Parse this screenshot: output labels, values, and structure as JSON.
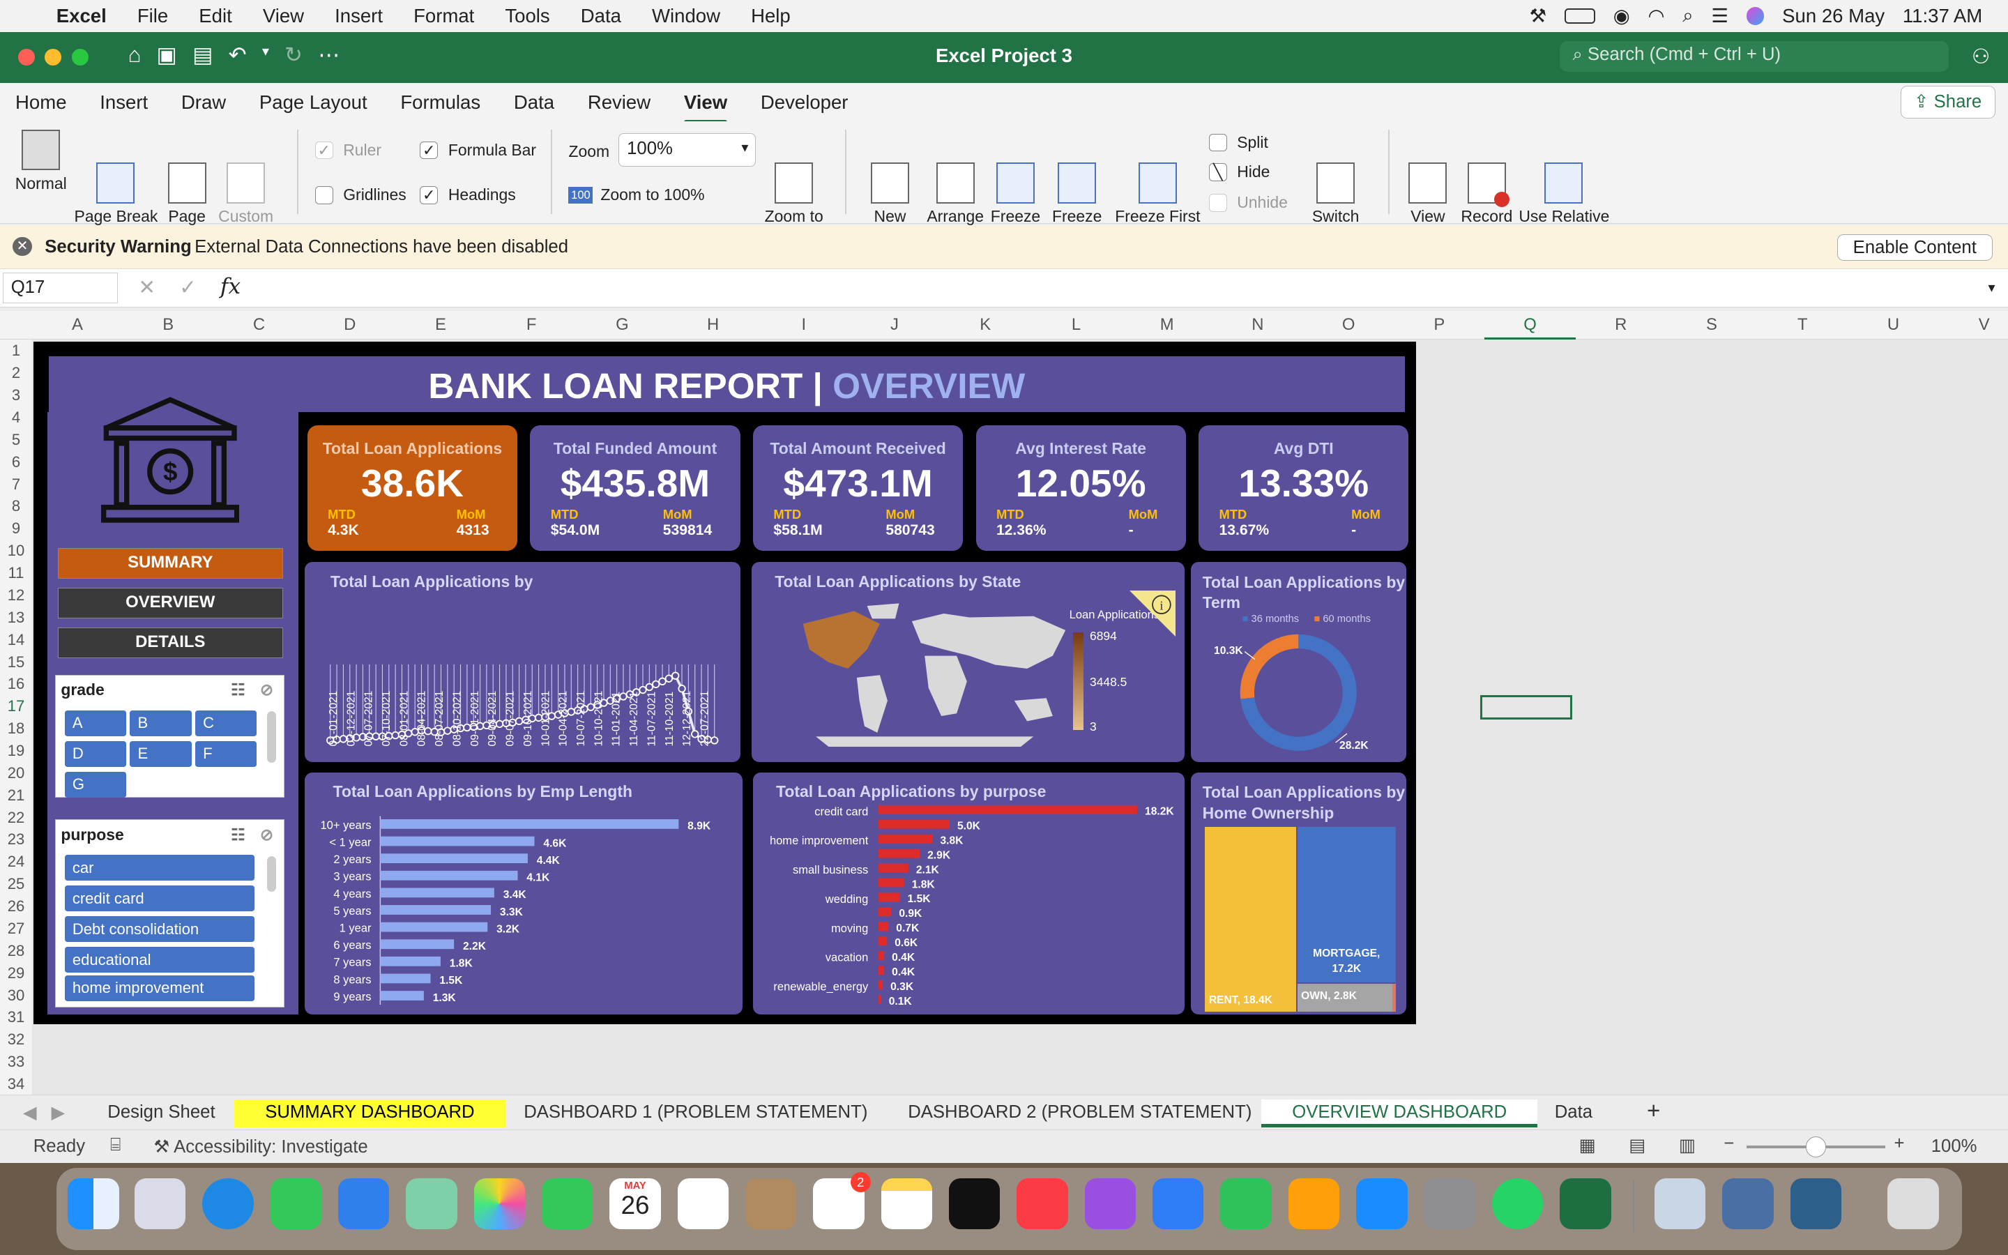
{
  "menubar": {
    "apple": "",
    "app": "Excel",
    "items": [
      "File",
      "Edit",
      "View",
      "Insert",
      "Format",
      "Tools",
      "Data",
      "Window",
      "Help"
    ],
    "date": "Sun 26 May",
    "time": "11:37 AM"
  },
  "window": {
    "title": "Excel Project 3",
    "search_placeholder": "Search (Cmd + Ctrl + U)"
  },
  "ribbon_tabs": [
    "Home",
    "Insert",
    "Draw",
    "Page Layout",
    "Formulas",
    "Data",
    "Review",
    "View",
    "Developer"
  ],
  "active_tab": "View",
  "share_label": "Share",
  "ribbon": {
    "normal": "Normal",
    "page_break": "Page Break\nPreview",
    "page_layout": "Page\nLayout",
    "custom_views": "Custom\nViews",
    "ruler": "Ruler",
    "formula_bar": "Formula Bar",
    "gridlines": "Gridlines",
    "headings": "Headings",
    "zoom_label": "Zoom",
    "zoom_value": "100%",
    "zoom_100": "Zoom to 100%",
    "zoom_badge": "100",
    "zoom_sel": "Zoom to\nSelection",
    "new_window": "New\nWindow",
    "arrange_all": "Arrange\nAll",
    "freeze_panes": "Freeze\nPanes",
    "freeze_top": "Freeze\nTop Row",
    "freeze_first": "Freeze First\nColumn",
    "split": "Split",
    "hide": "Hide",
    "unhide": "Unhide",
    "switch": "Switch\nWindows",
    "view_macros": "View\nMacros",
    "record_macro": "Record\nMacro",
    "relative": "Use Relative\nReferences"
  },
  "security": {
    "title": "Security Warning",
    "message": "External Data Connections have been disabled",
    "button": "Enable Content"
  },
  "formula": {
    "namebox": "Q17",
    "fx": "fx"
  },
  "columns": [
    "A",
    "B",
    "C",
    "D",
    "E",
    "F",
    "G",
    "H",
    "I",
    "J",
    "K",
    "L",
    "M",
    "N",
    "O",
    "P",
    "Q",
    "R",
    "S",
    "T",
    "U",
    "V"
  ],
  "rows": [
    "1",
    "2",
    "3",
    "4",
    "5",
    "6",
    "7",
    "8",
    "9",
    "10",
    "11",
    "12",
    "13",
    "14",
    "15",
    "16",
    "17",
    "18",
    "19",
    "20",
    "21",
    "22",
    "23",
    "24",
    "25",
    "26",
    "27",
    "28",
    "29",
    "30",
    "31",
    "32",
    "33",
    "34"
  ],
  "dashboard": {
    "title_main": "BANK LOAN REPORT | ",
    "title_sub": "OVERVIEW",
    "nav": [
      "SUMMARY",
      "OVERVIEW",
      "DETAILS"
    ],
    "grade_slicer": {
      "title": "grade",
      "items": [
        "A",
        "B",
        "C",
        "D",
        "E",
        "F",
        "G"
      ]
    },
    "purpose_slicer": {
      "title": "purpose",
      "items": [
        "car",
        "credit card",
        "Debt consolidation",
        "educational",
        "home improvement"
      ]
    },
    "kpis": [
      {
        "label": "Total Loan Applications",
        "value": "38.6K",
        "mtd": "4.3K",
        "mom": "4313"
      },
      {
        "label": "Total Funded Amount",
        "value": "$435.8M",
        "mtd": "$54.0M",
        "mom": "539814"
      },
      {
        "label": "Total Amount Received",
        "value": "$473.1M",
        "mtd": "$58.1M",
        "mom": "580743"
      },
      {
        "label": "Avg Interest Rate",
        "value": "12.05%",
        "mtd": "12.36%",
        "mom": "-"
      },
      {
        "label": "Avg DTI",
        "value": "13.33%",
        "mtd": "13.67%",
        "mom": "-"
      }
    ],
    "mtd_label": "MTD",
    "mom_label": "MoM"
  },
  "chart_data": [
    {
      "type": "line",
      "title": "Total Loan Applications by",
      "x": [
        "01-01-2021",
        "02-12-2021",
        "07-07-2021",
        "07-10-2021",
        "08-01-2021",
        "08-04-2021",
        "08-07-2021",
        "08-10-2021",
        "09-01-2021",
        "09-04-2021",
        "09-07-2021",
        "09-10-2021",
        "10-01-2021",
        "10-04-2021",
        "10-07-2021",
        "10-10-2021",
        "11-01-2021",
        "11-04-2021",
        "11-07-2021",
        "11-10-2021",
        "12-12-2021",
        "22-07-2021"
      ],
      "values": [
        3,
        4,
        5,
        5,
        6,
        8,
        7,
        9,
        10,
        11,
        12,
        14,
        15,
        17,
        19,
        22,
        25,
        28,
        32,
        36,
        4,
        3
      ]
    },
    {
      "type": "map",
      "title": "Total Loan Applications by State",
      "legend_title": "Loan Applications",
      "legend": [
        "6894",
        "3448.5",
        "3"
      ]
    },
    {
      "type": "pie",
      "title": "Total Loan Applications by Term",
      "categories": [
        "36 months",
        "60 months"
      ],
      "values": [
        28.2,
        10.3
      ],
      "labels": [
        "28.2K",
        "10.3K"
      ]
    },
    {
      "type": "bar",
      "title": "Total Loan Applications by Emp Length",
      "categories": [
        "10+ years",
        "< 1 year",
        "2 years",
        "3 years",
        "4 years",
        "5 years",
        "1 year",
        "6 years",
        "7 years",
        "8 years",
        "9 years"
      ],
      "values": [
        8.9,
        4.6,
        4.4,
        4.1,
        3.4,
        3.3,
        3.2,
        2.2,
        1.8,
        1.5,
        1.3
      ],
      "labels": [
        "8.9K",
        "4.6K",
        "4.4K",
        "4.1K",
        "3.4K",
        "3.3K",
        "3.2K",
        "2.2K",
        "1.8K",
        "1.5K",
        "1.3K"
      ]
    },
    {
      "type": "bar",
      "title": "Total Loan Applications by purpose",
      "categories": [
        "credit card",
        "home improvement",
        "small business",
        "wedding",
        "moving",
        "vacation",
        "renewable_energy"
      ],
      "values": [
        18.2,
        5.0,
        3.8,
        2.9,
        2.1,
        1.8,
        1.5,
        0.9,
        0.7,
        0.6,
        0.4,
        0.4,
        0.3,
        0.1
      ],
      "labels": [
        "18.2K",
        "5.0K",
        "3.8K",
        "2.9K",
        "2.1K",
        "1.8K",
        "1.5K",
        "0.9K",
        "0.7K",
        "0.6K",
        "0.4K",
        "0.4K",
        "0.3K",
        "0.1K"
      ]
    },
    {
      "type": "treemap",
      "title": "Total Loan Applications by Home Ownership",
      "categories": [
        "RENT",
        "MORTGAGE",
        "OWN"
      ],
      "values": [
        18.4,
        17.2,
        2.8
      ],
      "labels": [
        "RENT, 18.4K",
        "MORTGAGE,\n17.2K",
        "OWN, 2.8K"
      ]
    }
  ],
  "sheet_tabs": [
    "Design Sheet",
    "SUMMARY DASHBOARD",
    "DASHBOARD 1 (PROBLEM STATEMENT)",
    "DASHBOARD 2 (PROBLEM STATEMENT)",
    "OVERVIEW DASHBOARD",
    "Data",
    "+"
  ],
  "status": {
    "ready": "Ready",
    "accessibility": "Accessibility: Investigate",
    "zoom": "100%"
  },
  "dock_date": {
    "month": "MAY",
    "day": "26"
  },
  "badge": "2",
  "colors": {
    "excel_green": "#217346",
    "panel": "#5a4f9b",
    "orange": "#c55a11",
    "bar_blue": "#8ea9ef",
    "bar_red": "#e02b2b",
    "rent": "#f4bf3a",
    "mortgage": "#4472c4"
  }
}
